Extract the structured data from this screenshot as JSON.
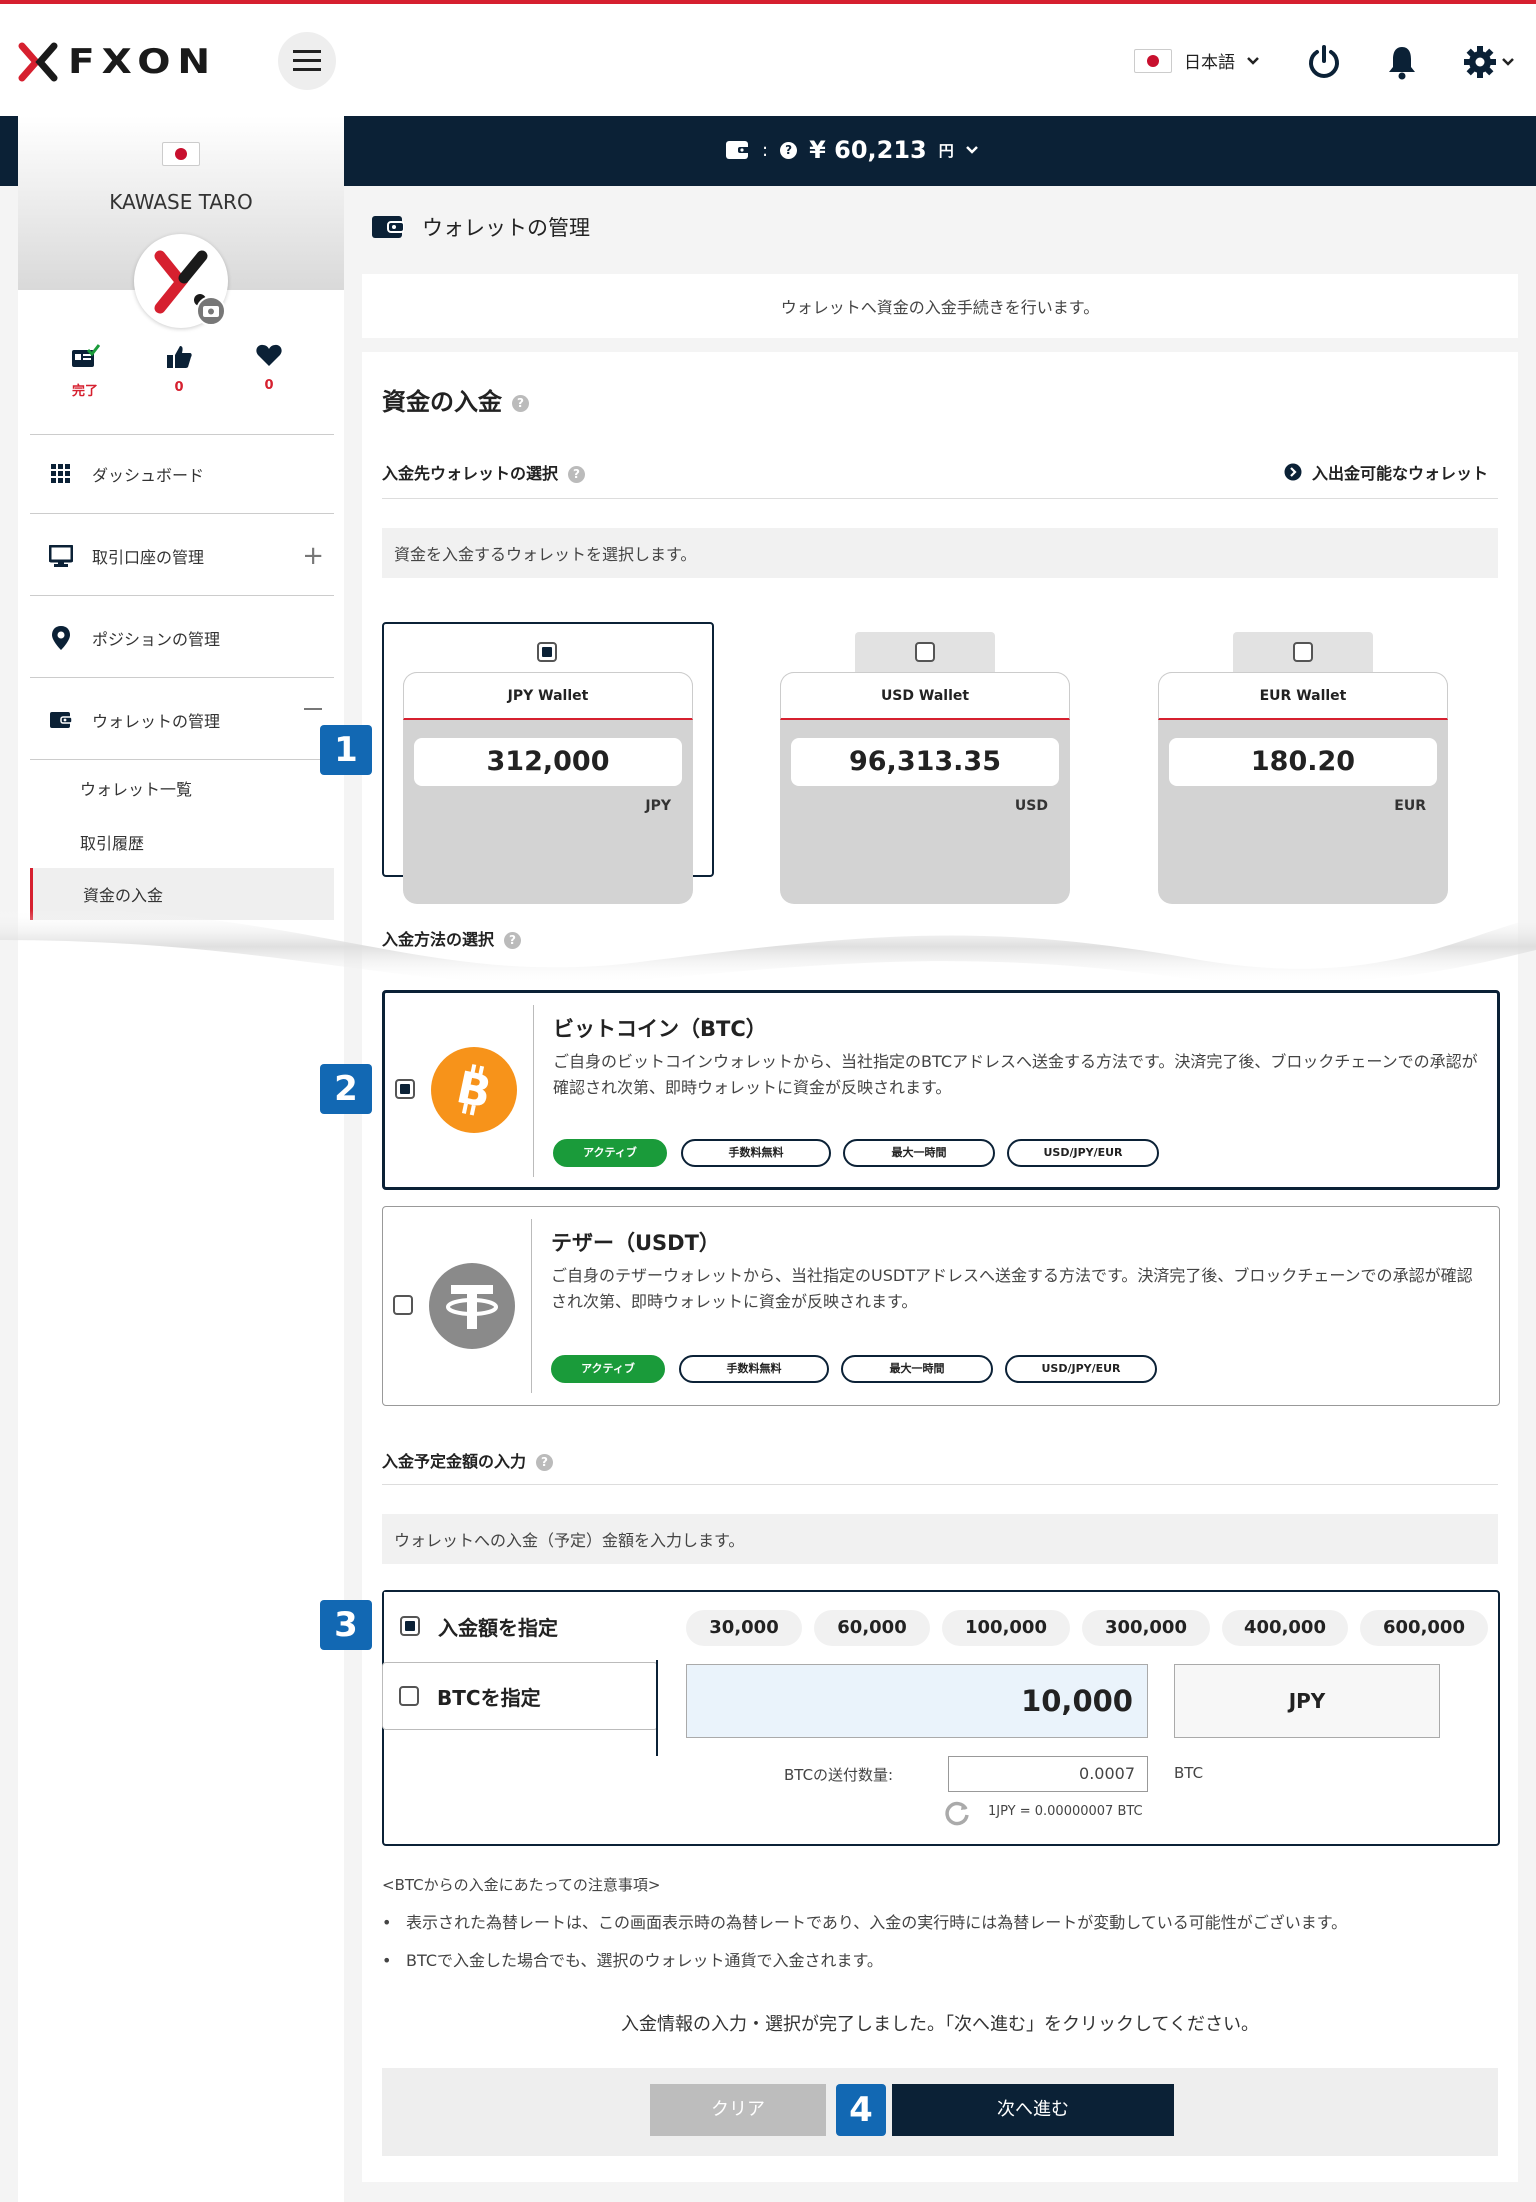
{
  "header": {
    "logo_text": "FXON",
    "language": "日本語",
    "balance_label": ":",
    "balance_value": "¥ 60,213",
    "balance_unit": "円"
  },
  "sidebar": {
    "user_name": "KAWASE TARO",
    "stats": [
      {
        "icon": "id-card-check-icon",
        "label": "完了",
        "color": "#d6202f"
      },
      {
        "icon": "thumbs-up-icon",
        "label": "0",
        "color": "#d6202f"
      },
      {
        "icon": "heart-icon",
        "label": "0",
        "color": "#d6202f"
      }
    ],
    "items": [
      {
        "label": "ダッシュボード",
        "icon": "grid-icon"
      },
      {
        "label": "取引口座の管理",
        "icon": "monitor-icon"
      },
      {
        "label": "ポジションの管理",
        "icon": "map-pin-icon"
      },
      {
        "label": "ウォレットの管理",
        "icon": "wallet-icon"
      }
    ],
    "subitems": [
      {
        "label": "ウォレット一覧"
      },
      {
        "label": "取引履歴"
      },
      {
        "label": "資金の入金"
      }
    ]
  },
  "page": {
    "title": "ウォレットの管理",
    "intro": "ウォレットへ資金の入金手続きを行います。",
    "section_title": "資金の入金",
    "wallet_select_title": "入金先ウォレットの選択",
    "wallet_link": "入出金可能なウォレット",
    "wallet_select_note": "資金を入金するウォレットを選択します。",
    "method_title": "入金方法の選択",
    "amount_title": "入金予定金額の入力",
    "amount_note": "ウォレットへの入金（予定）金額を入力します。"
  },
  "wallets": [
    {
      "name": "JPY Wallet",
      "value": "312,000",
      "currency": "JPY",
      "selected": true
    },
    {
      "name": "USD Wallet",
      "value": "96,313.35",
      "currency": "USD",
      "selected": false
    },
    {
      "name": "EUR Wallet",
      "value": "180.20",
      "currency": "EUR",
      "selected": false
    }
  ],
  "methods": [
    {
      "title": "ビットコイン（BTC）",
      "desc": "ご自身のビットコインウォレットから、当社指定のBTCアドレスへ送金する方法です。決済完了後、ブロックチェーンでの承認が確認され次第、即時ウォレットに資金が反映されます。",
      "tags": [
        "アクティブ",
        "手数料無料",
        "最大一時間",
        "USD/JPY/EUR"
      ],
      "selected": true
    },
    {
      "title": "テザー（USDT）",
      "desc": "ご自身のテザーウォレットから、当社指定のUSDTアドレスへ送金する方法です。決済完了後、ブロックチェーンでの承認が確認され次第、即時ウォレットに資金が反映されます。",
      "tags": [
        "アクティブ",
        "手数料無料",
        "最大一時間",
        "USD/JPY/EUR"
      ],
      "selected": false
    }
  ],
  "amount": {
    "option_amount": "入金額を指定",
    "option_btc": "BTCを指定",
    "presets": [
      "30,000",
      "60,000",
      "100,000",
      "300,000",
      "400,000",
      "600,000"
    ],
    "input_value": "10,000",
    "currency": "JPY",
    "btc_qty_label": "BTCの送付数量:",
    "btc_qty_value": "0.0007",
    "btc_unit": "BTC",
    "rate": "1JPY = 0.00000007 BTC"
  },
  "notes": {
    "heading": "<BTCからの入金にあたっての注意事項>",
    "items": [
      "表示された為替レートは、この画面表示時の為替レートであり、入金の実行時には為替レートが変動している可能性がございます。",
      "BTCで入金した場合でも、選択のウォレット通貨で入金されます。"
    ]
  },
  "footer": {
    "done_message": "入金情報の入力・選択が完了しました。「次へ進む」をクリックしてください。",
    "clear_label": "クリア",
    "next_label": "次へ進む"
  },
  "markers": [
    "1",
    "2",
    "3",
    "4"
  ],
  "colors": {
    "brand_red": "#d6202f",
    "navy": "#0b2136",
    "marker_blue": "#1268b3",
    "active_green": "#1a9b3a",
    "btc_orange": "#f7931a",
    "usdt_gray": "#8a8a8a"
  }
}
